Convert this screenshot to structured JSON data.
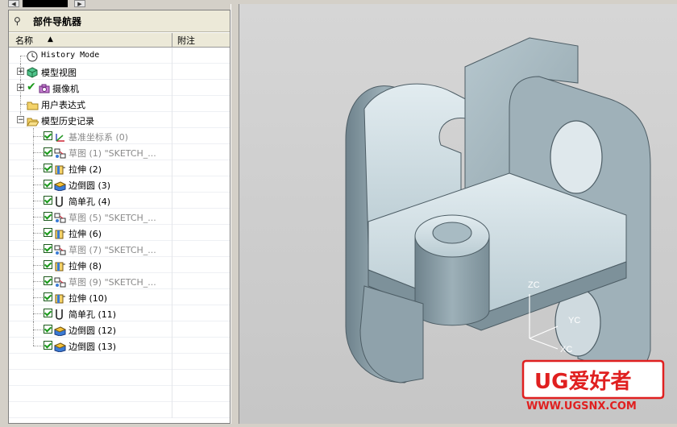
{
  "navigator": {
    "title": "部件导航器",
    "col_name": "名称",
    "col_note": "附注",
    "sort_indicator": "▲"
  },
  "tree": [
    {
      "label": "History Mode",
      "icon": "clock-icon",
      "dim": false,
      "mono": true
    },
    {
      "label": "模型视图",
      "icon": "model-views-icon",
      "dim": false,
      "mono": false
    },
    {
      "label": "摄像机",
      "icon": "camera-icon",
      "dim": false,
      "mono": false
    },
    {
      "label": "用户表达式",
      "icon": "folder-icon",
      "dim": false,
      "mono": false
    },
    {
      "label": "模型历史记录",
      "icon": "folder-open-icon",
      "dim": false,
      "mono": false
    },
    {
      "label": "基准坐标系 (0)",
      "icon": "datum-csys-icon",
      "dim": true,
      "mono": false
    },
    {
      "label": "草图 (1) \"SKETCH_...",
      "icon": "sketch-icon",
      "dim": true,
      "mono": false
    },
    {
      "label": "拉伸 (2)",
      "icon": "extrude-icon",
      "dim": false,
      "mono": false
    },
    {
      "label": "边倒圆 (3)",
      "icon": "edge-blend-icon",
      "dim": false,
      "mono": false
    },
    {
      "label": "简单孔 (4)",
      "icon": "hole-icon",
      "dim": false,
      "mono": false
    },
    {
      "label": "草图 (5) \"SKETCH_...",
      "icon": "sketch-icon",
      "dim": true,
      "mono": false
    },
    {
      "label": "拉伸 (6)",
      "icon": "extrude-icon",
      "dim": false,
      "mono": false
    },
    {
      "label": "草图 (7) \"SKETCH_...",
      "icon": "sketch-icon",
      "dim": true,
      "mono": false
    },
    {
      "label": "拉伸 (8)",
      "icon": "extrude-icon",
      "dim": false,
      "mono": false
    },
    {
      "label": "草图 (9) \"SKETCH_...",
      "icon": "sketch-icon",
      "dim": true,
      "mono": false
    },
    {
      "label": "拉伸 (10)",
      "icon": "extrude-icon",
      "dim": false,
      "mono": false
    },
    {
      "label": "简单孔 (11)",
      "icon": "hole-icon",
      "dim": false,
      "mono": false
    },
    {
      "label": "边倒圆 (12)",
      "icon": "edge-blend-icon",
      "dim": false,
      "mono": false
    },
    {
      "label": "边倒圆 (13)",
      "icon": "edge-blend-icon",
      "dim": false,
      "mono": false
    }
  ],
  "axes": {
    "z": "ZC",
    "y": "YC",
    "x": "XC"
  },
  "watermark": {
    "logo": "UG爱好者",
    "url": "WWW.UGSNX.COM"
  },
  "colors": {
    "part_face": "#a9bcc4",
    "part_dark": "#8799a2",
    "part_light": "#d3e1e6",
    "watermark_red": "#e02020",
    "check_green": "#1a9a1a"
  }
}
